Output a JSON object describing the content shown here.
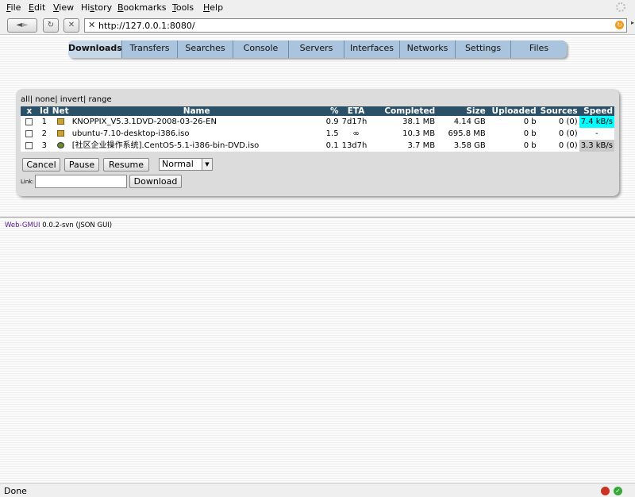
{
  "menu": {
    "items": [
      {
        "pre": "",
        "u": "F",
        "post": "ile"
      },
      {
        "pre": "",
        "u": "E",
        "post": "dit"
      },
      {
        "pre": "",
        "u": "V",
        "post": "iew"
      },
      {
        "pre": "Hi",
        "u": "s",
        "post": "tory"
      },
      {
        "pre": "",
        "u": "B",
        "post": "ookmarks"
      },
      {
        "pre": "",
        "u": "T",
        "post": "ools"
      },
      {
        "pre": "",
        "u": "H",
        "post": "elp"
      }
    ]
  },
  "nav": {
    "back": "◄",
    "forward": "►",
    "reload": "↻",
    "stop": "✕",
    "url": "http://127.0.0.1:8080/",
    "url_icon": "✕",
    "go_icon": "↻",
    "url_arrow": "▸"
  },
  "tabs": [
    "Downloads",
    "Transfers",
    "Searches",
    "Console",
    "Servers",
    "Interfaces",
    "Networks",
    "Settings",
    "Files"
  ],
  "selection": {
    "all": "all",
    "none": "none",
    "invert": "invert",
    "range": "range",
    "sep": "|"
  },
  "table": {
    "headers": [
      "x",
      "Id",
      "Net",
      "Name",
      "%",
      "ETA",
      "Completed",
      "Size",
      "Uploaded",
      "Sources",
      "Speed"
    ],
    "rows": [
      {
        "id": "1",
        "net_icon": "edonkey-icon",
        "name": "KNOPPIX_V5.3.1DVD-2008-03-26-EN",
        "pct": "0.9",
        "eta": "7d17h",
        "completed": "38.1 MB",
        "size": "4.14 GB",
        "uploaded": "0 b",
        "sources": "0 (0)",
        "speed": "7.4 kB/s",
        "speed_style": "hi"
      },
      {
        "id": "2",
        "net_icon": "edonkey-icon",
        "name": "ubuntu-7.10-desktop-i386.iso",
        "pct": "1.5",
        "eta": "∞",
        "completed": "10.3 MB",
        "size": "695.8 MB",
        "uploaded": "0 b",
        "sources": "0 (0)",
        "speed": "-",
        "speed_style": "none"
      },
      {
        "id": "3",
        "net_icon": "bittorrent-icon",
        "name": "[社区企业操作系统].CentOS-5.1-i386-bin-DVD.iso",
        "pct": "0.1",
        "eta": "13d7h",
        "completed": "3.7 MB",
        "size": "3.58 GB",
        "uploaded": "0 b",
        "sources": "0 (0)",
        "speed": "3.3 kB/s",
        "speed_style": "mid"
      }
    ]
  },
  "controls": {
    "cancel": "Cancel",
    "pause": "Pause",
    "resume": "Resume",
    "priority": "Normal",
    "priority_arrow": "▼",
    "link_label": "Link:",
    "link_value": "",
    "download": "Download"
  },
  "footer": {
    "link": "Web-GMUI",
    "text": " 0.0.2-svn (JSON GUI)"
  },
  "status": {
    "text": "Done"
  },
  "colors": {
    "accent": "#2b5168",
    "tab_bar": "#a9c4dc",
    "speed_high": "#00ffff"
  }
}
